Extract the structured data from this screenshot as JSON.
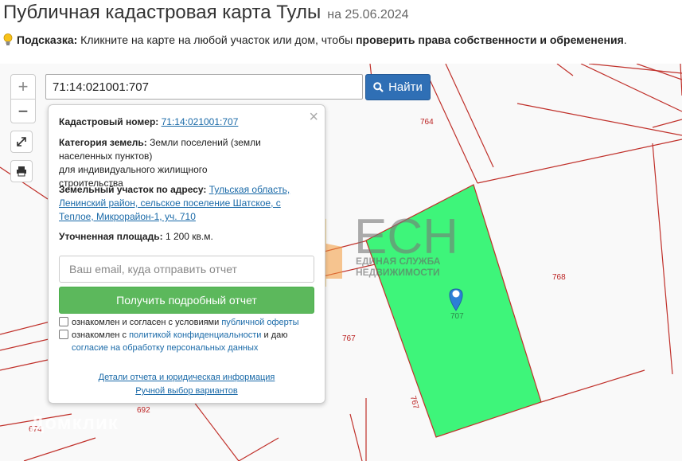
{
  "header": {
    "title": "Публичная кадастровая карта Тулы",
    "date": "на 25.06.2024"
  },
  "hint": {
    "label": "Подсказка:",
    "text": " Кликните на карте на любой участок или дом, чтобы ",
    "bold": "проверить права собственности и обременения",
    "end": "."
  },
  "search": {
    "value": "71:14:021001:707",
    "button": "Найти"
  },
  "zoom": {
    "plus": "+",
    "minus": "−"
  },
  "popup": {
    "close": "×",
    "cad_label": "Кадастровый номер:",
    "cad_value": "71:14:021001:707",
    "cat_label": "Категория земель:",
    "cat_value": "Земли поселений (земли населенных пунктов)",
    "cat_use": "для индивидуального жилищного строительства",
    "addr_label": "Земельный участок по адресу:",
    "addr_value": "Тульская область, Ленинский район, сельское поселение Шатское, с Теплое, Микрорайон-1, уч. 710",
    "area_label": "Уточненная площадь:",
    "area_value": "1 200 кв.м.",
    "email_placeholder": "Ваш email, куда отправить отчет",
    "report_button": "Получить подробный отчет",
    "check1_text": "ознакомлен и согласен с условиями ",
    "check1_link": "публичной оферты",
    "check2_text": "ознакомлен с ",
    "check2_link": "политикой конфиденциальности",
    "check2_mid": " и даю",
    "check2_link2": "согласие на обработку персональных данных",
    "details_link": "Детали отчета и юридическая информация",
    "manual_link": "Ручной выбор вариантов"
  },
  "map": {
    "parcel_labels": [
      "764",
      "768",
      "767",
      "767",
      "707",
      "692",
      "674"
    ],
    "logo": {
      "big": "ЕСН",
      "line1": "ЕДИНАЯ СЛУЖБА",
      "line2": "НЕДВИЖИМОСТИ"
    },
    "watermark": "Домклик",
    "colors": {
      "boundary": "#c0302a",
      "selected": "#3ef57a",
      "marker": "#2c7fd6"
    }
  }
}
